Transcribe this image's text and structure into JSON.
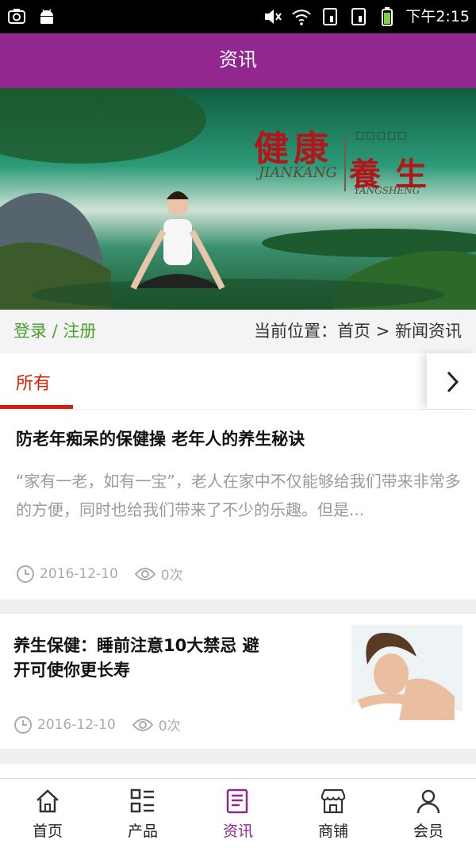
{
  "status_bar": {
    "time": "下午2:15"
  },
  "header": {
    "title": "资讯"
  },
  "banner": {
    "heading_1": "健康",
    "heading_2": "養生",
    "sub_1": "JIANKANG",
    "sub_2": "YANGSHENG",
    "placeholder_squares": "□□□□□"
  },
  "location_bar": {
    "login_register": "登录 / 注册",
    "breadcrumb": "当前位置：首页 > 新闻资讯"
  },
  "tabs": {
    "all_label": "所有"
  },
  "articles": [
    {
      "title": "防老年痴呆的保健操 老年人的养生秘诀",
      "summary": "“家有一老，如有一宝”，老人在家中不仅能够给我们带来非常多的方便，同时也给我们带来了不少的乐趣。但是...",
      "date": "2016-12-10",
      "views": "0次"
    },
    {
      "title_line1": "养生保健：睡前注意10大禁忌 避",
      "title_line2": "开可使你更长寿",
      "date": "2016-12-10",
      "views": "0次"
    }
  ],
  "bottom_nav": [
    {
      "label": "首页"
    },
    {
      "label": "产品"
    },
    {
      "label": "资讯"
    },
    {
      "label": "商铺"
    },
    {
      "label": "会员"
    }
  ],
  "colors": {
    "primary": "#92278f",
    "accent_red": "#d81e06",
    "green": "#4aa02c"
  }
}
